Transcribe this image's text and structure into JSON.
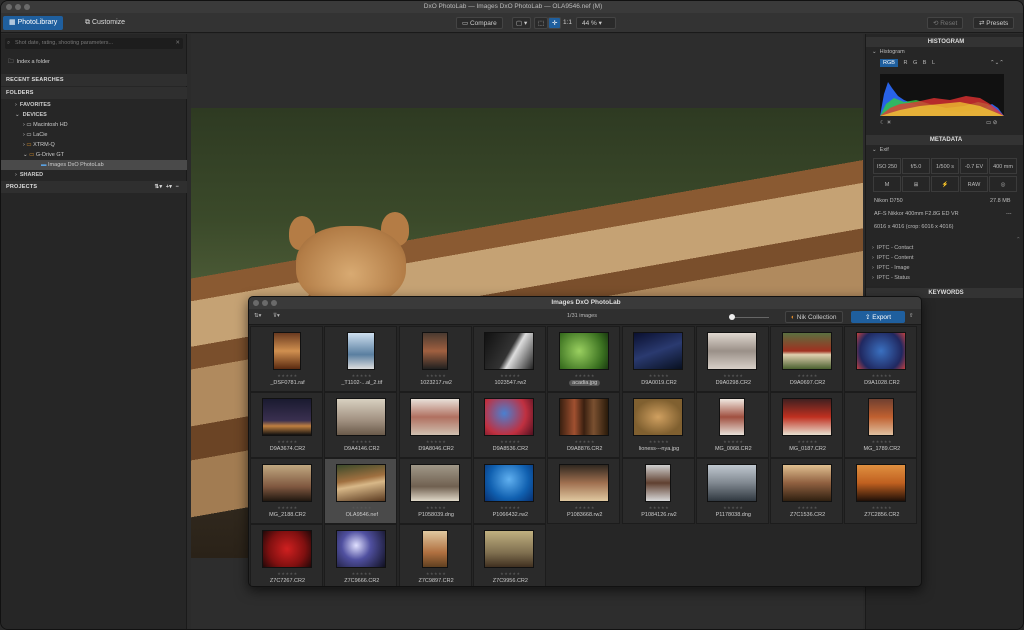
{
  "window": {
    "title": "DxO PhotoLab — Images DxO PhotoLab — OLA9546.nef (M)"
  },
  "toolbar": {
    "tab_library": "PhotoLibrary",
    "tab_customize": "Customize",
    "compare": "Compare",
    "ratio": "1:1",
    "zoom": "44 %",
    "reset": "Reset",
    "presets": "Presets"
  },
  "left": {
    "search_placeholder": "Shot date, rating, shooting parameters...",
    "index_folder": "Index a folder",
    "recent_searches": "RECENT SEARCHES",
    "folders": "FOLDERS",
    "favorites": "FAVORITES",
    "devices": "DEVICES",
    "device_items": [
      "Macintosh HD",
      "LaCie",
      "XTRM-Q",
      "G-Drive GT"
    ],
    "selected_folder": "Images DxO PhotoLab",
    "shared": "SHARED",
    "projects": "PROJECTS"
  },
  "right": {
    "histogram_header": "HISTOGRAM",
    "histogram_label": "Histogram",
    "channels": [
      "RGB",
      "R",
      "G",
      "B",
      "L"
    ],
    "metadata_header": "METADATA",
    "exif_label": "Exif",
    "exif_values": [
      "ISO 250",
      "f/5.0",
      "1/500 s",
      "-0.7 EV",
      "400 mm"
    ],
    "exif_icons": [
      "M",
      "",
      "",
      "RAW",
      ""
    ],
    "camera": "Nikon D750",
    "filesize": "27.8 MB",
    "lens": "AF-S Nikkor 400mm F2.8G ED VR",
    "lens_value": "---",
    "dimensions": "6016 x 4016 (crop: 6016 x 4016)",
    "iptc": [
      "IPTC - Contact",
      "IPTC - Content",
      "IPTC - Image",
      "IPTC - Status"
    ],
    "keywords_header": "KEYWORDS"
  },
  "browser": {
    "title": "Images DxO PhotoLab",
    "count": "1/31 images",
    "nik": "Nik Collection",
    "export": "Export",
    "files": [
      "_DSF0781.raf",
      "_T1102-...al_2.tif",
      "1023217.rw2",
      "1023547.rw2",
      "acadia.jpg",
      "D9A0019.CR2",
      "D9A0298.CR2",
      "D9A0697.CR2",
      "D9A1028.CR2",
      "D9A3674.CR2",
      "D9A4146.CR2",
      "D9A8046.CR2",
      "D9A8536.CR2",
      "D9A8876.CR2",
      "lioness---nya.jpg",
      "MG_0068.CR2",
      "MG_0187.CR2",
      "MG_1789.CR2",
      "MG_2188.CR2",
      "OLA9546.nef",
      "P1058039.dng",
      "P1066432.rw2",
      "P1083668.rw2",
      "P1084126.rw2",
      "P1178038.dng",
      "Z7C1536.CR2",
      "Z7C2856.CR2",
      "Z7C7267.CR2",
      "Z7C9666.CR2",
      "Z7C9897.CR2",
      "Z7C9956.CR2"
    ],
    "stars": "★★★★★"
  },
  "colors": {
    "accent": "#1f5f9e"
  }
}
